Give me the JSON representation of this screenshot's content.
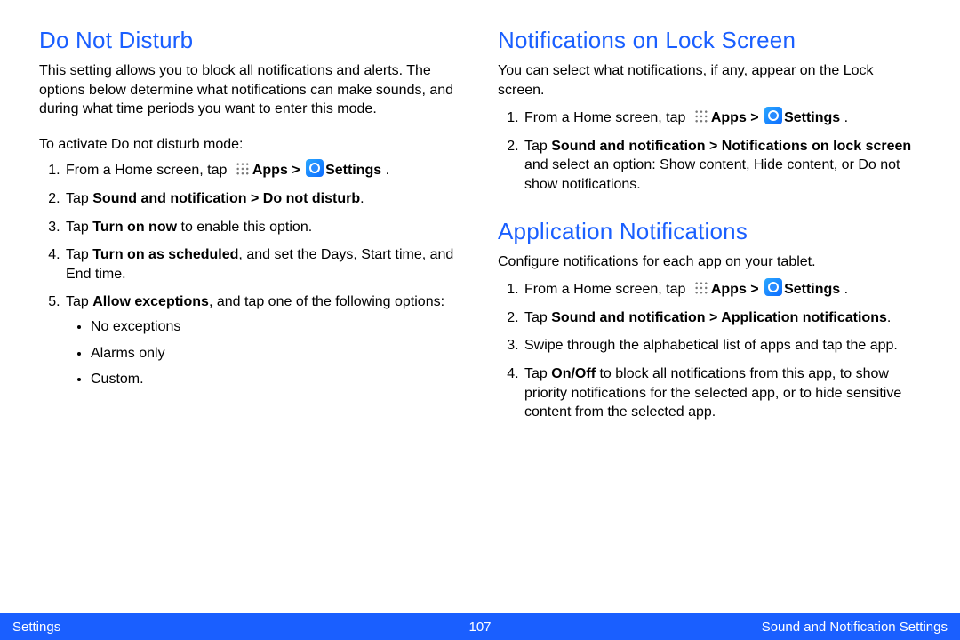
{
  "left": {
    "title": "Do Not Disturb",
    "intro": "This setting allows you to block all notifications and alerts. The options below determine what notifications can make sounds, and during what time periods you want to enter this mode.",
    "leadin": "To activate Do not disturb mode:",
    "step1_pre": "From a Home screen, tap ",
    "step1_apps": "Apps",
    "step1_gt": " > ",
    "step1_settings": "Settings",
    "step1_post": " .",
    "step2_pre": "Tap ",
    "step2_bold": "Sound and notification > Do not disturb",
    "step2_post": ".",
    "step3_pre": "Tap ",
    "step3_bold": "Turn on now",
    "step3_post": " to enable this option.",
    "step4_pre": "Tap ",
    "step4_bold": "Turn on as scheduled",
    "step4_post": ", and set the Days, Start time, and End time.",
    "step5_pre": "Tap ",
    "step5_bold": "Allow exceptions",
    "step5_post": ", and tap one of the following options:",
    "bullets": [
      "No exceptions",
      "Alarms only",
      "Custom."
    ]
  },
  "right1": {
    "title": "Notifications on Lock Screen",
    "intro": "You can select what notifications, if any, appear on the Lock screen.",
    "step1_pre": "From a Home screen, tap ",
    "step1_apps": "Apps",
    "step1_gt": " > ",
    "step1_settings": "Settings",
    "step1_post": " .",
    "step2_pre": "Tap ",
    "step2_bold": "Sound and notification > Notifications on lock screen",
    "step2_post": " and select an option: Show content, Hide content, or Do not show notifications."
  },
  "right2": {
    "title": "Application Notifications",
    "intro": "Configure notifications for each app on your tablet.",
    "step1_pre": "From a Home screen, tap ",
    "step1_apps": "Apps",
    "step1_gt": " > ",
    "step1_settings": "Settings",
    "step1_post": " .",
    "step2_pre": "Tap ",
    "step2_bold": "Sound and notification > Application notifications",
    "step2_post": ".",
    "step3": "Swipe through the alphabetical list of apps and tap the app.",
    "step4_pre": "Tap ",
    "step4_bold": "On/Off",
    "step4_post": " to block all notifications from this app, to show priority notifications for the selected app, or to hide sensitive content from the selected app."
  },
  "footer": {
    "left": "Settings",
    "page": "107",
    "right": "Sound and Notification Settings"
  }
}
